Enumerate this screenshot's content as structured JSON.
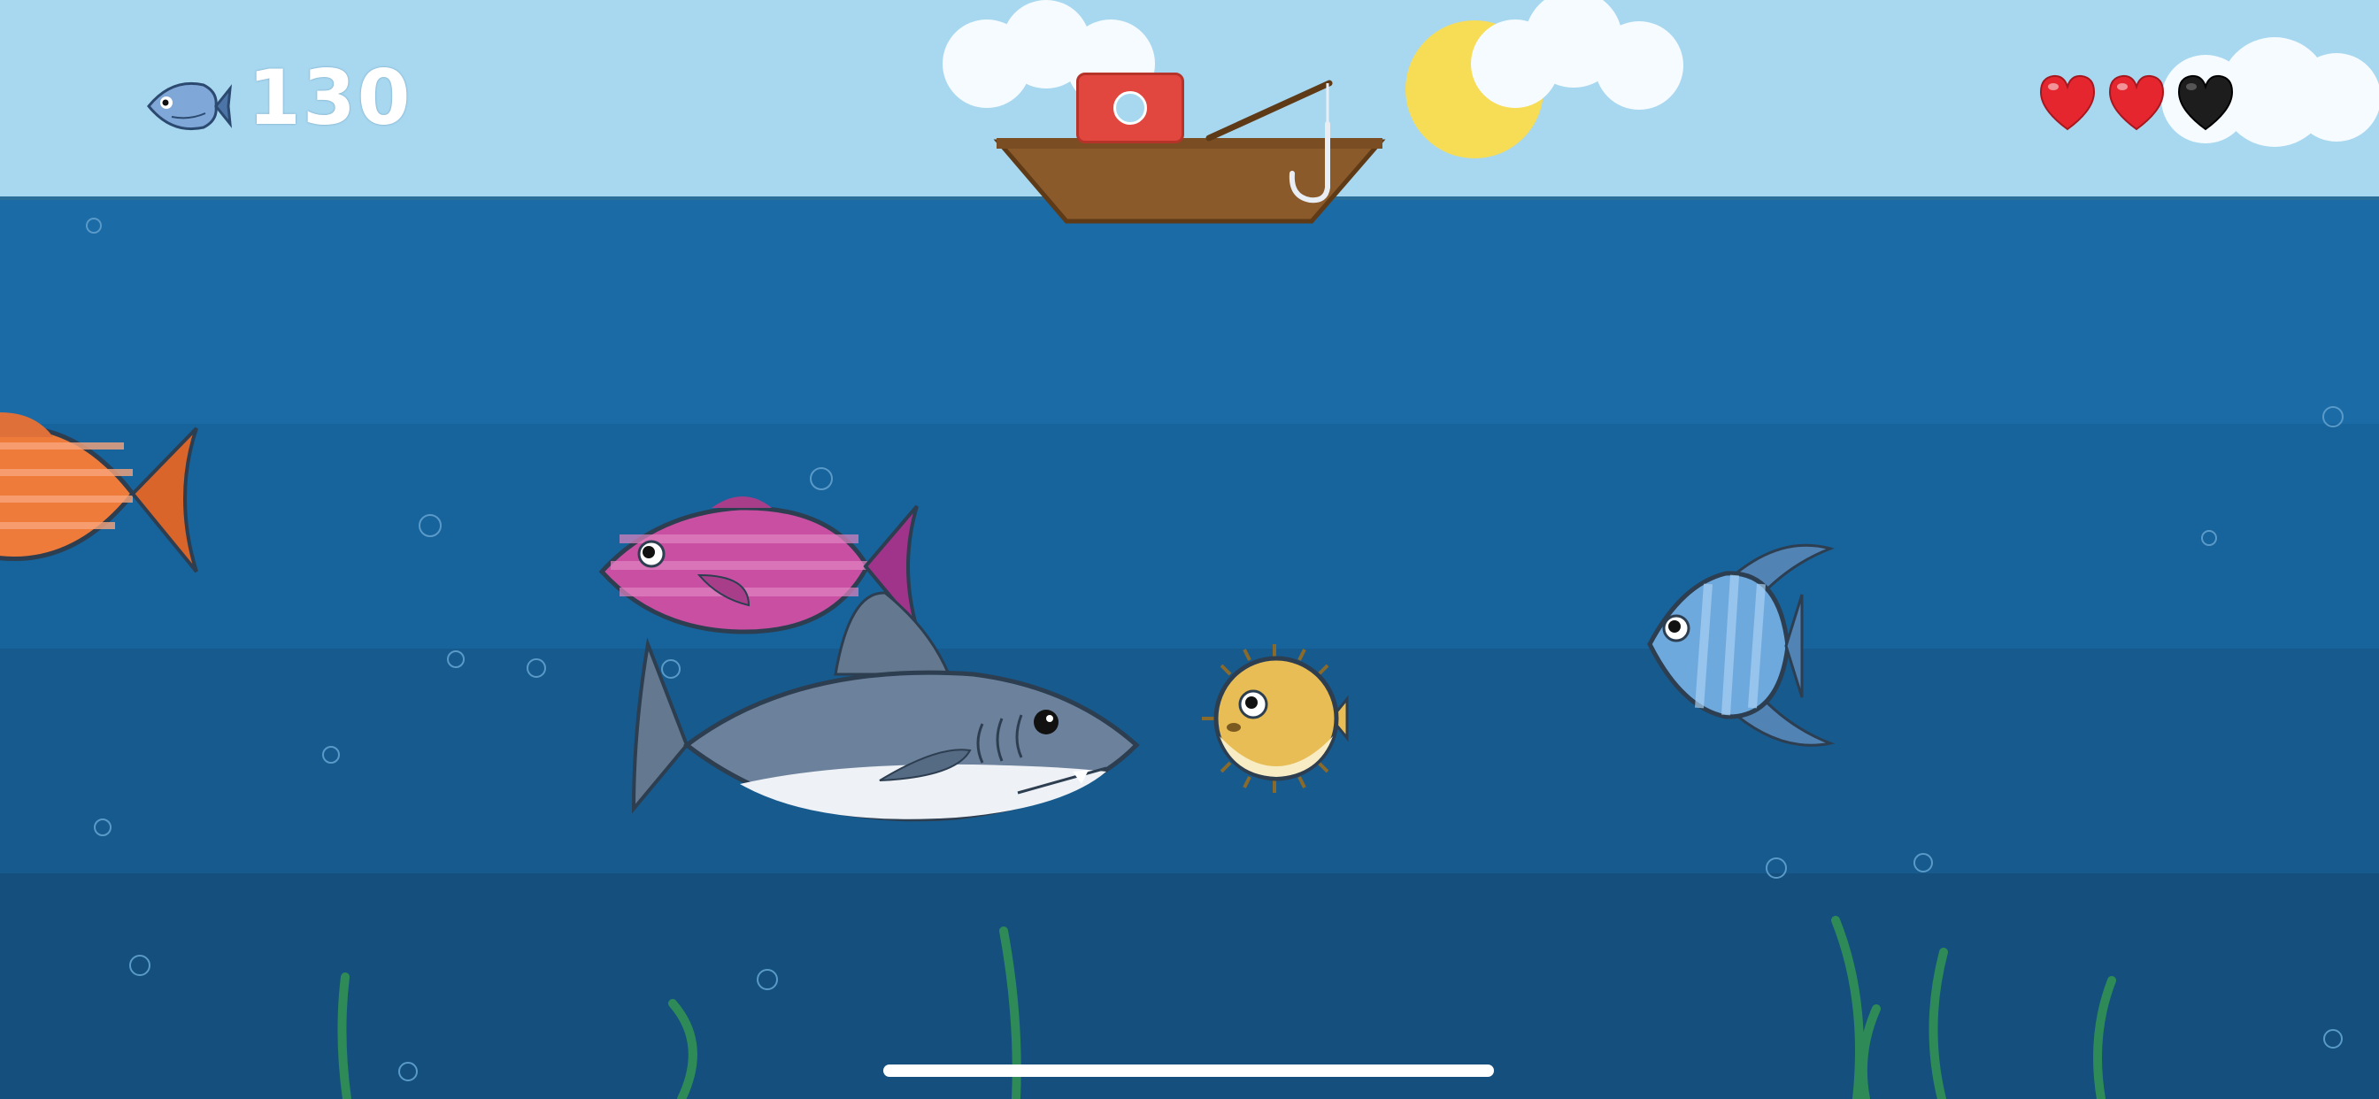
{
  "hud": {
    "score": "130",
    "score_icon": "fish-icon",
    "lives_total": 3,
    "lives_remaining": 2,
    "heart_full_color": "#e5262f",
    "heart_empty_color": "#1d1d1d"
  },
  "boat": {
    "button_icon": "record-button-icon",
    "button_color": "#e1473f"
  },
  "colors": {
    "sky": "#a8d8f0",
    "water_surface": "#1a6ba6",
    "water_band_2": "#17639c",
    "water_band_3": "#165a8e",
    "water_deep": "#144f7e",
    "seaweed": "#2e8b57",
    "sun": "#f7dc55"
  },
  "creatures": [
    {
      "name": "orange-striped-fish",
      "color": "#ef7b3a"
    },
    {
      "name": "pink-striped-fish",
      "color": "#c94fa3"
    },
    {
      "name": "shark",
      "color": "#6c819c"
    },
    {
      "name": "pufferfish",
      "color": "#e9bd55"
    },
    {
      "name": "blue-angelfish",
      "color": "#6ea9de"
    }
  ]
}
